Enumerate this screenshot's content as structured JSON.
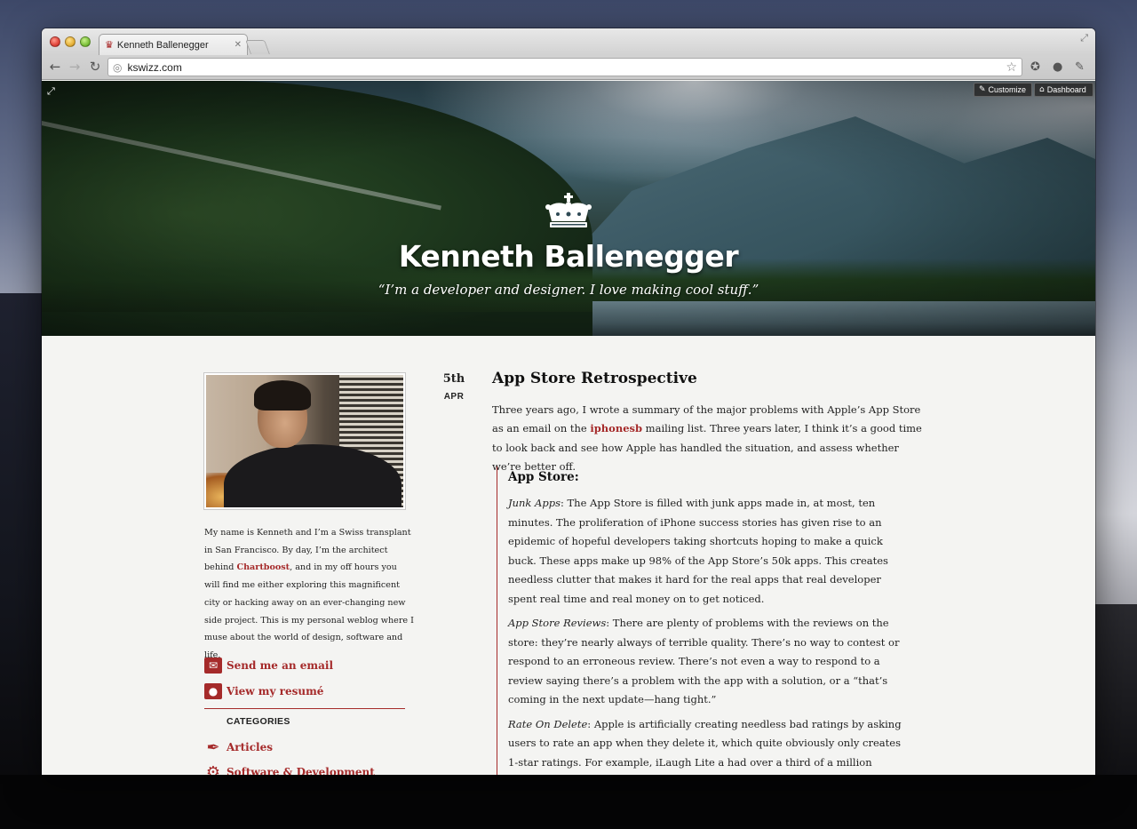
{
  "browser": {
    "tab_title": "Kenneth Ballenegger",
    "tab_close": "✕",
    "url": "kswizz.com"
  },
  "hero": {
    "name": "Kenneth Ballenegger",
    "tagline": "“I’m a developer and designer. I love making cool stuff.”",
    "customize_label": "Customize",
    "dashboard_label": "Dashboard"
  },
  "sidebar": {
    "bio_1": "My name is Kenneth and I’m a Swiss transplant in San Francisco. By day, I’m the architect behind ",
    "bio_link": "Chartboost",
    "bio_2": ", and in my off hours you will find me either exploring this magnificent city or hacking away on an ever-changing new side project. This is my personal weblog where I muse about the world of design, software and life.",
    "email_label": "Send me an email",
    "resume_label": "View my resumé",
    "categories_title": "CATEGORIES",
    "categories": [
      "Articles",
      "Software & Development"
    ]
  },
  "post": {
    "day": "5th",
    "month": "APR",
    "title": "App Store Retrospective",
    "intro_1": "Three years ago, I wrote a summary of the major problems with Apple’s App Store as an email on the ",
    "intro_link": "iphonesb",
    "intro_2": " mailing list. Three years later, I think it’s a good time to look back and see how Apple has handled the situation, and assess whether we’re better off.",
    "quote_heading": "App Store:",
    "paragraphs": [
      {
        "label": "Junk Apps",
        "text": ": The App Store is filled with junk apps made in, at most, ten minutes. The proliferation of iPhone success stories has given rise to an epidemic of hopeful developers taking shortcuts hoping to make a quick buck. These apps make up 98% of the App Store’s 50k apps. This creates needless clutter that makes it hard for the real apps that real developer spent real time and real money on to get noticed."
      },
      {
        "label": "App Store Reviews",
        "text": ": There are plenty of problems with the reviews on the store: they’re nearly always of terrible quality. There’s no way to contest or respond to an erroneous review. There’s not even a way to respond to a review saying there’s a problem with the app with a solution, or a “that’s coming in the next update—hang tight.”"
      },
      {
        "label": "Rate On Delete",
        "text": ": Apple is artificially creating needless bad ratings by asking users to rate an app when they delete it, which quite obviously only creates 1-star ratings. For example, iLaugh Lite a had over a third of a million users, and many"
      }
    ]
  }
}
